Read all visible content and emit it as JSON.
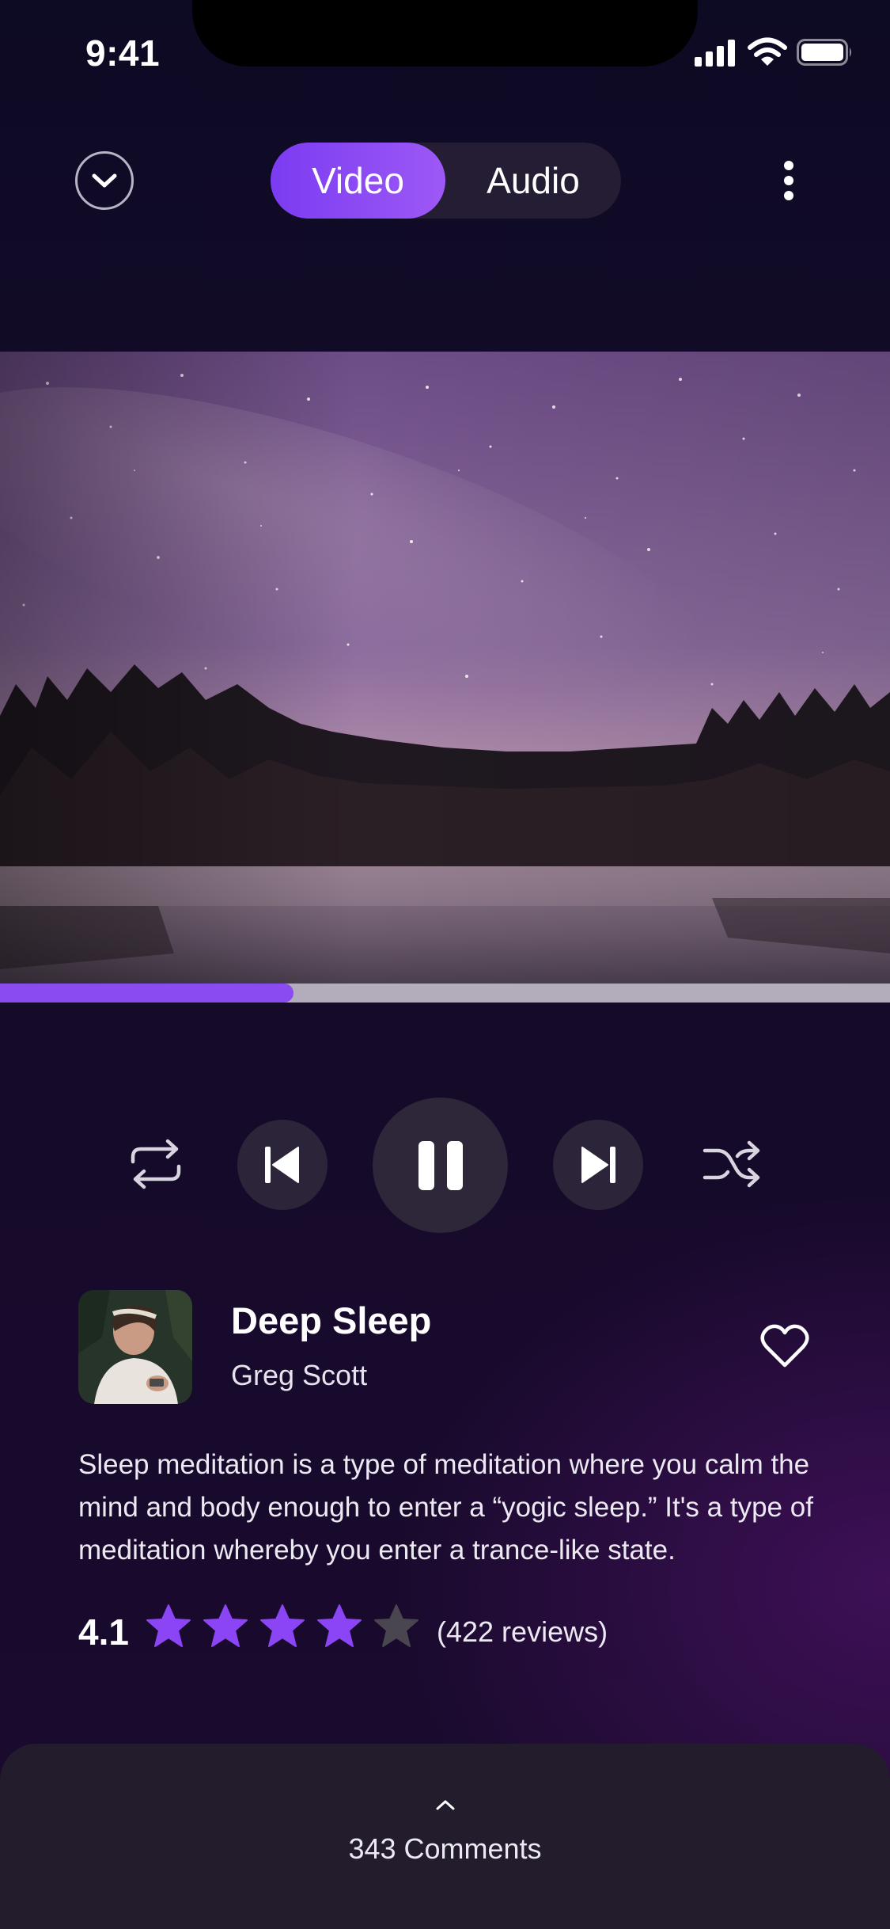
{
  "status_bar": {
    "time": "9:41",
    "icons": [
      "signal-icon",
      "wifi-icon",
      "battery-icon"
    ]
  },
  "header": {
    "collapse_icon": "chevron-down-icon",
    "tabs": [
      {
        "label": "Video",
        "selected": true
      },
      {
        "label": "Audio",
        "selected": false
      }
    ],
    "more_icon": "more-vertical-icon"
  },
  "player": {
    "progress_fraction": 0.33,
    "controls": [
      "repeat-icon",
      "skip-previous-icon",
      "pause-icon",
      "skip-next-icon",
      "shuffle-icon"
    ]
  },
  "track": {
    "title": "Deep Sleep",
    "artist": "Greg Scott",
    "favorite_icon": "heart-icon",
    "description": "Sleep meditation is a type of meditation where you calm the mind and body enough to enter a “yogic sleep.” It's a type of meditation whereby you enter a trance-like state.",
    "rating": "4.1",
    "stars_filled": 4,
    "stars_total": 5,
    "reviews": "(422 reviews)"
  },
  "comments": {
    "label": "343 Comments",
    "expand_icon": "chevron-up-icon"
  },
  "colors": {
    "accent": "#8a4cf0",
    "star_filled": "#8b45f5",
    "star_empty": "#4a4650",
    "sheet": "#221c2c"
  }
}
